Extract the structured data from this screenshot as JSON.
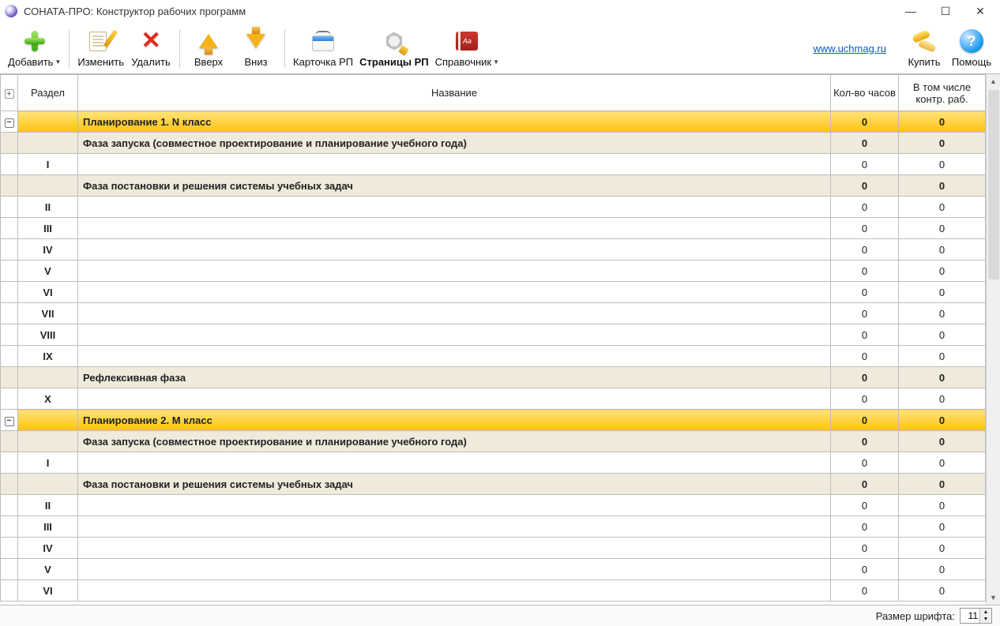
{
  "window": {
    "title": "СОНАТА-ПРО: Конструктор рабочих программ"
  },
  "toolbar": {
    "add": "Добавить",
    "edit": "Изменить",
    "delete": "Удалить",
    "up": "Вверх",
    "down": "Вниз",
    "card": "Карточка РП",
    "pages": "Страницы РП",
    "reference": "Справочник",
    "link": "www.uchmag.ru",
    "buy": "Купить",
    "help": "Помощь"
  },
  "columns": {
    "expand": "+",
    "section": "Раздел",
    "name": "Название",
    "hours": "Кол-во часов",
    "kontrol": "В том числе контр. раб."
  },
  "rows": [
    {
      "type": "plan",
      "exp": "−",
      "section": "",
      "name": "Планирование 1. N класс",
      "hours": "0",
      "k": "0"
    },
    {
      "type": "phase",
      "section": "",
      "name": "Фаза запуска (совместное проектирование и  планирование учебного года)",
      "hours": "0",
      "k": "0"
    },
    {
      "type": "item",
      "section": "I",
      "name": "",
      "hours": "0",
      "k": "0"
    },
    {
      "type": "phase",
      "section": "",
      "name": "Фаза постановки и решения системы учебных задач",
      "hours": "0",
      "k": "0"
    },
    {
      "type": "item",
      "section": "II",
      "name": "",
      "hours": "0",
      "k": "0"
    },
    {
      "type": "item",
      "section": "III",
      "name": "",
      "hours": "0",
      "k": "0"
    },
    {
      "type": "item",
      "section": "IV",
      "name": "",
      "hours": "0",
      "k": "0"
    },
    {
      "type": "item",
      "section": "V",
      "name": "",
      "hours": "0",
      "k": "0"
    },
    {
      "type": "item",
      "section": "VI",
      "name": "",
      "hours": "0",
      "k": "0"
    },
    {
      "type": "item",
      "section": "VII",
      "name": "",
      "hours": "0",
      "k": "0"
    },
    {
      "type": "item",
      "section": "VIII",
      "name": "",
      "hours": "0",
      "k": "0"
    },
    {
      "type": "item",
      "section": "IX",
      "name": "",
      "hours": "0",
      "k": "0"
    },
    {
      "type": "phase",
      "section": "",
      "name": "Рефлексивная фаза",
      "hours": "0",
      "k": "0"
    },
    {
      "type": "item",
      "section": "X",
      "name": "",
      "hours": "0",
      "k": "0"
    },
    {
      "type": "plan",
      "exp": "−",
      "section": "",
      "name": "Планирование 2. M класс",
      "hours": "0",
      "k": "0"
    },
    {
      "type": "phase",
      "section": "",
      "name": "Фаза запуска (совместное проектирование и  планирование учебного года)",
      "hours": "0",
      "k": "0"
    },
    {
      "type": "item",
      "section": "I",
      "name": "",
      "hours": "0",
      "k": "0"
    },
    {
      "type": "phase",
      "section": "",
      "name": "Фаза постановки и решения системы учебных задач",
      "hours": "0",
      "k": "0"
    },
    {
      "type": "item",
      "section": "II",
      "name": "",
      "hours": "0",
      "k": "0"
    },
    {
      "type": "item",
      "section": "III",
      "name": "",
      "hours": "0",
      "k": "0"
    },
    {
      "type": "item",
      "section": "IV",
      "name": "",
      "hours": "0",
      "k": "0"
    },
    {
      "type": "item",
      "section": "V",
      "name": "",
      "hours": "0",
      "k": "0"
    },
    {
      "type": "item",
      "section": "VI",
      "name": "",
      "hours": "0",
      "k": "0"
    }
  ],
  "status": {
    "fontSizeLabel": "Размер шрифта:",
    "fontSize": "11"
  },
  "book_label": "Aa"
}
